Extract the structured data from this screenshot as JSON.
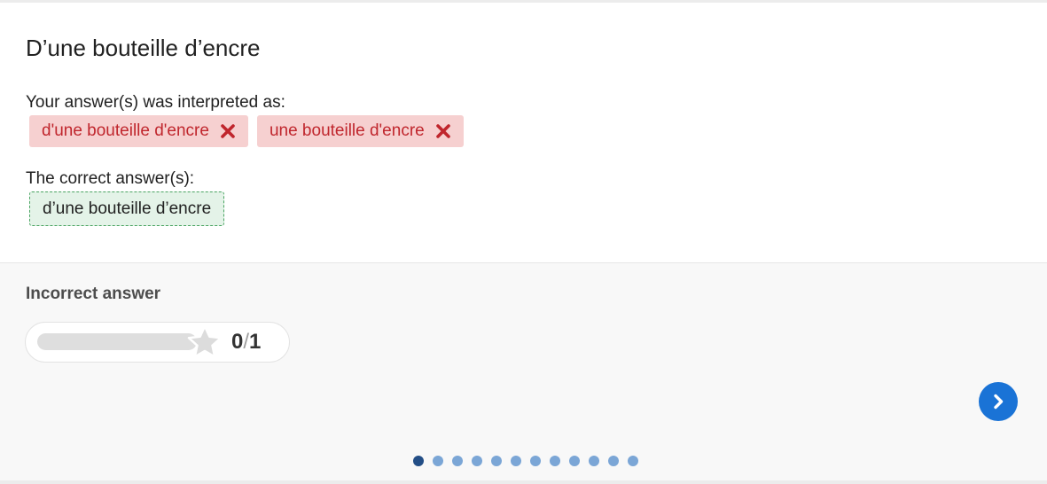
{
  "question": {
    "title": "D’une bouteille d’encre"
  },
  "interpretation": {
    "label": "Your answer(s) was interpreted as:",
    "answers": [
      {
        "text": "d'une bouteille d'encre",
        "status": "incorrect",
        "icon": "close-icon"
      },
      {
        "text": "une bouteille d'encre",
        "status": "incorrect",
        "icon": "close-icon"
      }
    ]
  },
  "correct": {
    "label": "The correct answer(s):",
    "answers": [
      "d’une bouteille d’encre"
    ]
  },
  "feedback": {
    "text": "Incorrect answer",
    "score": {
      "current": "0",
      "separator": "/",
      "total": "1",
      "progress_fraction": 0
    },
    "icon": "star-icon"
  },
  "navigation": {
    "next_icon": "chevron-right-icon",
    "dots_count": 12,
    "active_dot": 1
  },
  "colors": {
    "wrong_bg": "#f6d0d0",
    "wrong_text": "#c0262d",
    "correct_bg": "#e4f3e8",
    "correct_border": "#4aa462",
    "accent": "#1a73d6",
    "dot": "#7ba6d6",
    "dot_active": "#234e86"
  }
}
